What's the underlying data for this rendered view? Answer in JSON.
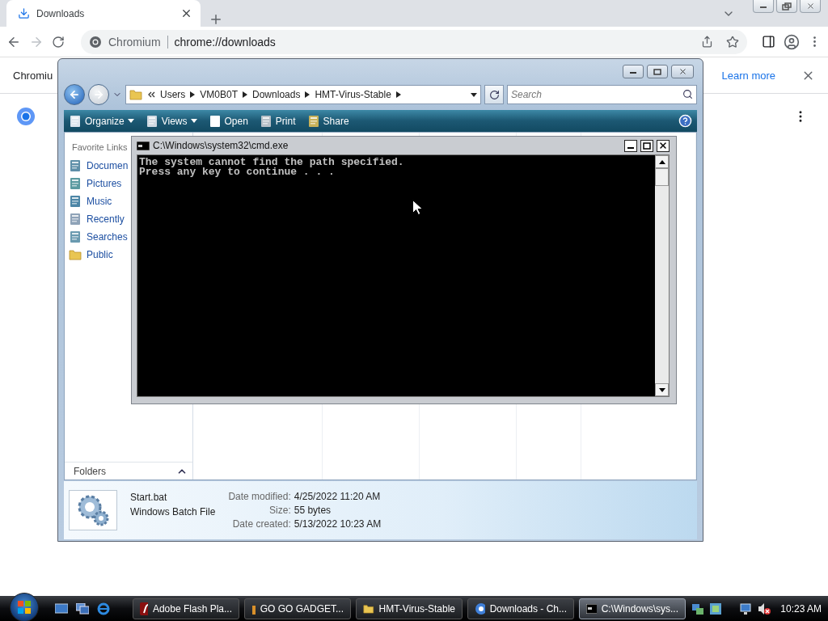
{
  "browser": {
    "tab": {
      "title": "Downloads",
      "selected": true
    },
    "address": {
      "site": "Chromium",
      "url": "chrome://downloads"
    },
    "infobar": {
      "text": "Chromiu",
      "link": "Learn more"
    }
  },
  "explorer": {
    "breadcrumbs": [
      "Users",
      "VM0B0T",
      "Downloads",
      "HMT-Virus-Stable"
    ],
    "search": {
      "placeholder": "Search"
    },
    "toolbar": [
      {
        "label": "Organize",
        "kind": "menu"
      },
      {
        "label": "Views",
        "kind": "menu"
      },
      {
        "label": "Open",
        "kind": "button"
      },
      {
        "label": "Print",
        "kind": "button"
      },
      {
        "label": "Share",
        "kind": "button"
      }
    ],
    "favorites_title": "Favorite Links",
    "favorites": [
      "Documen",
      "Pictures",
      "Music",
      "Recently",
      "Searches",
      "Public"
    ],
    "folders_label": "Folders",
    "details": {
      "name": "Start.bat",
      "type": "Windows Batch File",
      "fields": [
        {
          "label": "Date modified:",
          "value": "4/25/2022 11:20 AM"
        },
        {
          "label": "Size:",
          "value": "55 bytes"
        },
        {
          "label": "Date created:",
          "value": "5/13/2022 10:23 AM"
        }
      ]
    }
  },
  "console": {
    "title": "C:\\Windows\\system32\\cmd.exe",
    "lines": [
      "The system cannot find the path specified.",
      "Press any key to continue . . ."
    ]
  },
  "taskbar": {
    "tasks": [
      {
        "label": "Adobe Flash Pla...",
        "selected": false
      },
      {
        "label": "GO GO GADGET...",
        "selected": false
      },
      {
        "label": "HMT-Virus-Stable",
        "selected": false
      },
      {
        "label": "Downloads - Ch...",
        "selected": false
      },
      {
        "label": "C:\\Windows\\sys...",
        "selected": true
      }
    ],
    "clock": "10:23 AM"
  }
}
